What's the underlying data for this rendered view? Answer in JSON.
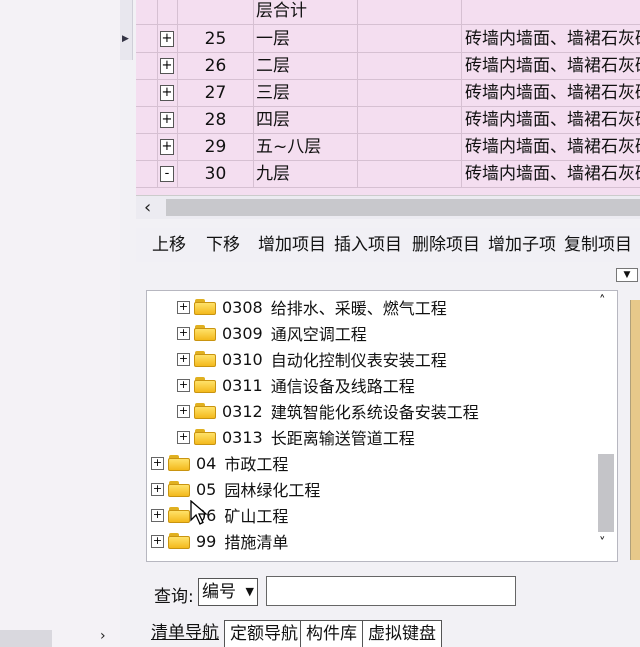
{
  "grid": {
    "partial_row": {
      "name": "层合计"
    },
    "rows": [
      {
        "toggle": "+",
        "num": "25",
        "name": "一层",
        "desc": "砖墙内墙面、墙裙石灰砂"
      },
      {
        "toggle": "+",
        "num": "26",
        "name": "二层",
        "desc": "砖墙内墙面、墙裙石灰砂"
      },
      {
        "toggle": "+",
        "num": "27",
        "name": "三层",
        "desc": "砖墙内墙面、墙裙石灰砂"
      },
      {
        "toggle": "+",
        "num": "28",
        "name": "四层",
        "desc": "砖墙内墙面、墙裙石灰砂"
      },
      {
        "toggle": "+",
        "num": "29",
        "name": "五~八层",
        "desc": "砖墙内墙面、墙裙石灰砂"
      },
      {
        "toggle": "-",
        "num": "30",
        "name": "九层",
        "desc": "砖墙内墙面、墙裙石灰砂"
      }
    ]
  },
  "toolbar": {
    "move_up": "上移",
    "move_down": "下移",
    "add_item": "增加项目",
    "insert_item": "插入项目",
    "delete_item": "删除项目",
    "add_child": "增加子项",
    "copy_item": "复制项目"
  },
  "tree": {
    "items": [
      {
        "code": "0308",
        "name": "给排水、采暖、燃气工程"
      },
      {
        "code": "0309",
        "name": "通风空调工程"
      },
      {
        "code": "0310",
        "name": "自动化控制仪表安装工程"
      },
      {
        "code": "0311",
        "name": "通信设备及线路工程"
      },
      {
        "code": "0312",
        "name": "建筑智能化系统设备安装工程"
      },
      {
        "code": "0313",
        "name": "长距离输送管道工程"
      },
      {
        "code": "04",
        "name": "市政工程"
      },
      {
        "code": "05",
        "name": "园林绿化工程"
      },
      {
        "code": "06",
        "name": "矿山工程"
      },
      {
        "code": "99",
        "name": "措施清单"
      }
    ]
  },
  "search": {
    "label": "查询:",
    "field": "编号",
    "value": ""
  },
  "tabs": [
    "清单导航",
    "定额导航",
    "构件库",
    "虚拟键盘"
  ]
}
